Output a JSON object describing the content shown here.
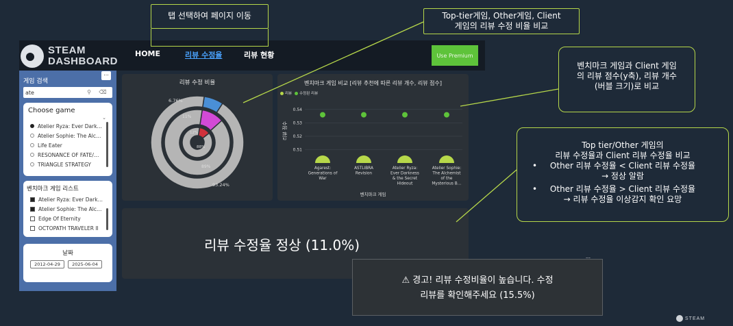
{
  "app": {
    "logo_line1": "STEAM",
    "logo_line2": "DASHBOARD"
  },
  "nav": {
    "tabs": [
      {
        "label": "HOME",
        "active": false
      },
      {
        "label": "리뷰 수정율",
        "active": true
      },
      {
        "label": "리뷰 현황",
        "active": false
      }
    ],
    "premium_label": "Use Premium"
  },
  "sidebar": {
    "search_title": "게임 검색",
    "more_label": "...",
    "search_value": "ate",
    "search_icon": "search-icon",
    "eraser_icon": "eraser-icon",
    "choose_game": {
      "title": "Choose game",
      "options": [
        {
          "label": "Atelier Ryza: Ever Dark…",
          "selected": true
        },
        {
          "label": "Atelier Sophie: The Alc…",
          "selected": false
        },
        {
          "label": "Life Eater",
          "selected": false
        },
        {
          "label": "RESONANCE OF FATE/…",
          "selected": false
        },
        {
          "label": "TRIANGLE STRATEGY",
          "selected": false
        }
      ]
    },
    "benchmark": {
      "title": "벤치마크 게임 리스트",
      "items": [
        {
          "label": "Atelier Ryza: Ever Dark…",
          "checked": true
        },
        {
          "label": "Atelier Sophie: The Alc…",
          "checked": true
        },
        {
          "label": "Edge Of Eternity",
          "checked": false
        },
        {
          "label": "OCTOPATH TRAVELER II",
          "checked": false
        }
      ]
    },
    "date": {
      "title": "날짜",
      "start": "2012-04-29",
      "end": "2025-06-04"
    }
  },
  "donut_panel": {
    "title": "리뷰 수정 비율",
    "labels": {
      "outer_small": "6.76%",
      "outer_big": "93.24%",
      "mid_small": "11%",
      "mid_big": "89%",
      "inner_small": "12%",
      "inner_big": "88%"
    }
  },
  "bench_panel": {
    "title": "벤치마크 게임 비교 [리뷰 추천에 따른 리뷰 개수, 리뷰 점수]",
    "legend": [
      {
        "name": "리뷰",
        "color": "#b7d84a"
      },
      {
        "name": "수정된 리뷰",
        "color": "#5ec33a"
      }
    ],
    "ylabel": "리뷰 점수",
    "xlabel": "벤치마크 게임"
  },
  "chart_data": {
    "type": "scatter",
    "title": "벤치마크 게임 비교 [리뷰 추천에 따른 리뷰 개수, 리뷰 점수]",
    "xlabel": "벤치마크 게임",
    "ylabel": "리뷰 점수",
    "ylim": [
      0.5,
      0.545
    ],
    "yticks": [
      "0.54",
      "0.53",
      "0.52",
      "0.51"
    ],
    "categories": [
      "Agarest: Generations of War",
      "ASTLIBRA Revision",
      "Atelier Ryza: Ever Darkness & the Secret Hideout",
      "Atelier Sophie: The Alchemist of the Mysterious B…"
    ],
    "category_labels": [
      [
        "Agarest:",
        "Generations of",
        "War"
      ],
      [
        "ASTLIBRA",
        "Revision"
      ],
      [
        "Atelier Ryza:",
        "Ever Darkness",
        "& the Secret",
        "Hideout"
      ],
      [
        "Atelier Sophie:",
        "The Alchemist",
        "of the",
        "Mysterious B…"
      ]
    ],
    "series": [
      {
        "name": "리뷰",
        "color": "#b7d84a",
        "values": [
          0.508,
          0.508,
          0.508,
          0.508
        ]
      },
      {
        "name": "수정된 리뷰",
        "color": "#5ec33a",
        "values": [
          0.536,
          0.536,
          0.536,
          0.536
        ]
      }
    ]
  },
  "donut_data": {
    "rings": [
      {
        "name": "outer",
        "values": [
          6.76,
          93.24
        ],
        "colors": [
          "#4a8fd6",
          "#b5b5b5"
        ]
      },
      {
        "name": "middle",
        "values": [
          11,
          89
        ],
        "colors": [
          "#d24ad6",
          "#b5b5b5"
        ]
      },
      {
        "name": "inner",
        "values": [
          12,
          88
        ],
        "colors": [
          "#d0313c",
          "#b5b5b5"
        ]
      }
    ]
  },
  "status": {
    "normal_text": "리뷰 수정율 정상 (11.0%)",
    "warning_line1": "⚠ 경고! 리뷰 수정비율이 높습니다. 수정",
    "warning_line2": "리뷰를 확인해주세요 (15.5%)"
  },
  "annotations": {
    "tab_note": "탭 선택하여 페이지 이동",
    "compare_note_1": "Top-tier게임, Other게임, Client",
    "compare_note_2": "게임의 리뷰 수정 비율 비교",
    "bench_note_1": "벤치마크 게임과 Client 게임",
    "bench_note_2": "의 리뷰 점수(y축), 리뷰 개수",
    "bench_note_3": "(버블 크기)로 비교",
    "rule_title_1": "Top tier/Other 게임의",
    "rule_title_2": "리뷰 수정율과 Client 리뷰 수정율 비교",
    "rule_1a": "Other 리뷰 수정율 < Client 리뷰 수정율",
    "rule_1b": "→ 정상 알람",
    "rule_2a": "Other 리뷰 수정율 > Client 리뷰 수정율",
    "rule_2b": "→ 리뷰 수정율 이상감지 확인 요망",
    "bullet": "•",
    "ellipsis_mark": "––"
  },
  "footer": {
    "steam_label": "STEAM"
  },
  "colors": {
    "accent": "#b7d84a",
    "bg": "#1e2a38",
    "sidebar": "#4c6fa8",
    "active_tab": "#4aa3ff",
    "premium": "#5ec33a"
  }
}
